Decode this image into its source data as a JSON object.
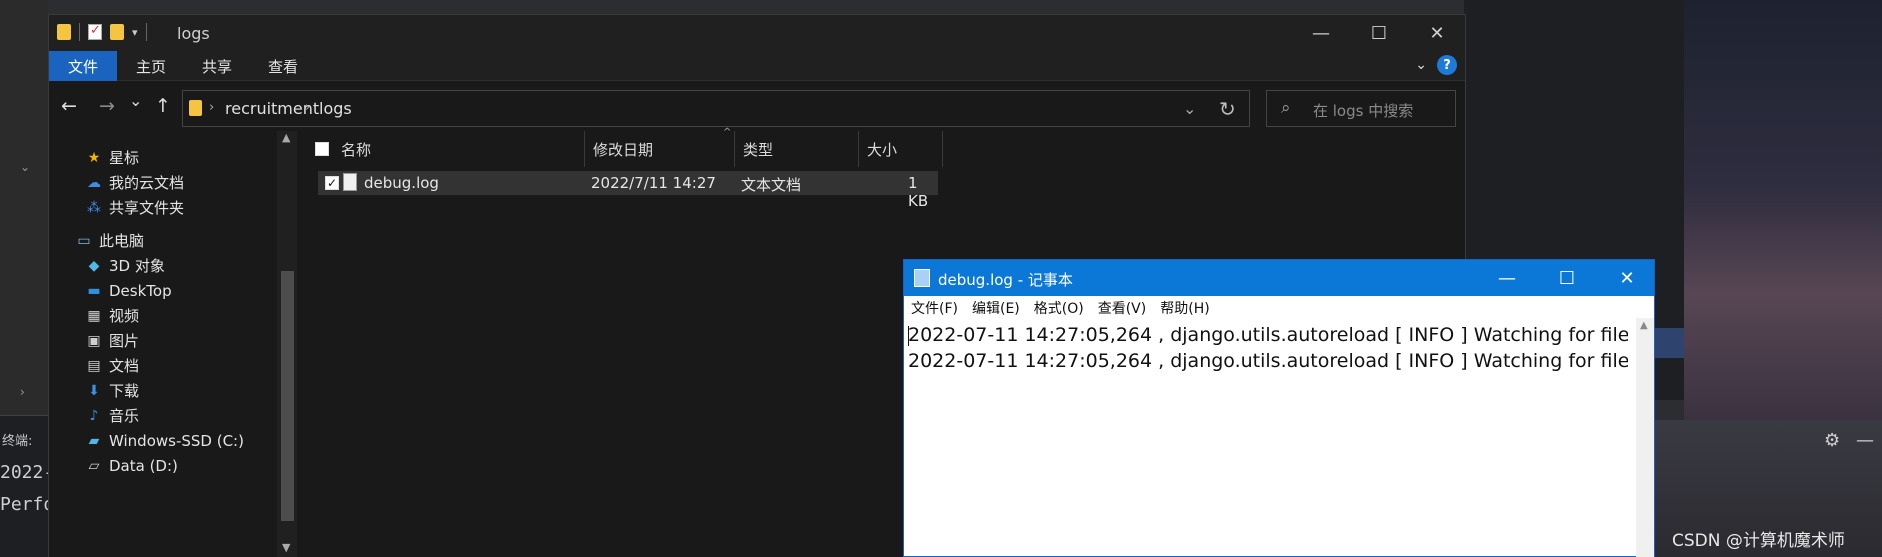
{
  "background": {
    "terminal_label": "终端:",
    "terminal_line1": "2022-",
    "terminal_line2": "Perfo",
    "watermark": "CSDN @计算机魔术师"
  },
  "explorer": {
    "title": "logs",
    "window_buttons": {
      "minimize": "—",
      "maximize": "☐",
      "close": "✕"
    },
    "ribbon_tabs": [
      "文件",
      "主页",
      "共享",
      "查看"
    ],
    "ribbon_help": "?",
    "nav_buttons": {
      "back": "←",
      "forward": "→",
      "recent": "⌄",
      "up": "↑"
    },
    "breadcrumb": [
      "recruitment",
      "logs"
    ],
    "search_placeholder": "在 logs 中搜索",
    "nav_items": [
      {
        "label": "星标",
        "icon": "star-icon",
        "glyph": "★",
        "color": "#f5b400"
      },
      {
        "label": "我的云文档",
        "icon": "cloud-icon",
        "glyph": "☁",
        "color": "#3c8ee8"
      },
      {
        "label": "共享文件夹",
        "icon": "share-icon",
        "glyph": "⁂",
        "color": "#3c8ee8"
      },
      {
        "label": "此电脑",
        "icon": "computer-icon",
        "glyph": "▭",
        "color": "#7fb4e8"
      },
      {
        "label": "3D 对象",
        "icon": "cube-icon",
        "glyph": "◆",
        "color": "#4fb8e6"
      },
      {
        "label": "DeskTop",
        "icon": "desktop-icon",
        "glyph": "▬",
        "color": "#2f8fe0"
      },
      {
        "label": "视频",
        "icon": "video-icon",
        "glyph": "▦",
        "color": "#cfcfcf"
      },
      {
        "label": "图片",
        "icon": "picture-icon",
        "glyph": "▣",
        "color": "#cfcfcf"
      },
      {
        "label": "文档",
        "icon": "document-icon",
        "glyph": "▤",
        "color": "#cfcfcf"
      },
      {
        "label": "下载",
        "icon": "download-icon",
        "glyph": "⬇",
        "color": "#3c8ee8"
      },
      {
        "label": "音乐",
        "icon": "music-icon",
        "glyph": "♪",
        "color": "#3c8ee8"
      },
      {
        "label": "Windows-SSD (C:)",
        "icon": "drive-c-icon",
        "glyph": "▰",
        "color": "#4fb8e6"
      },
      {
        "label": "Data (D:)",
        "icon": "drive-d-icon",
        "glyph": "▱",
        "color": "#cfcfcf"
      }
    ],
    "columns": [
      "名称",
      "修改日期",
      "类型",
      "大小"
    ],
    "files": [
      {
        "name": "debug.log",
        "modified": "2022/7/11 14:27",
        "type": "文本文档",
        "size": "1 KB",
        "checked": true
      }
    ]
  },
  "notepad": {
    "title": "debug.log - 记事本",
    "window_buttons": {
      "minimize": "—",
      "maximize": "☐",
      "close": "✕"
    },
    "menu": [
      "文件(F)",
      "编辑(E)",
      "格式(O)",
      "查看(V)",
      "帮助(H)"
    ],
    "lines": [
      "2022-07-11 14:27:05,264 , django.utils.autoreload [ INFO ] Watching for file",
      "2022-07-11 14:27:05,264 , django.utils.autoreload [ INFO ] Watching for file"
    ]
  }
}
